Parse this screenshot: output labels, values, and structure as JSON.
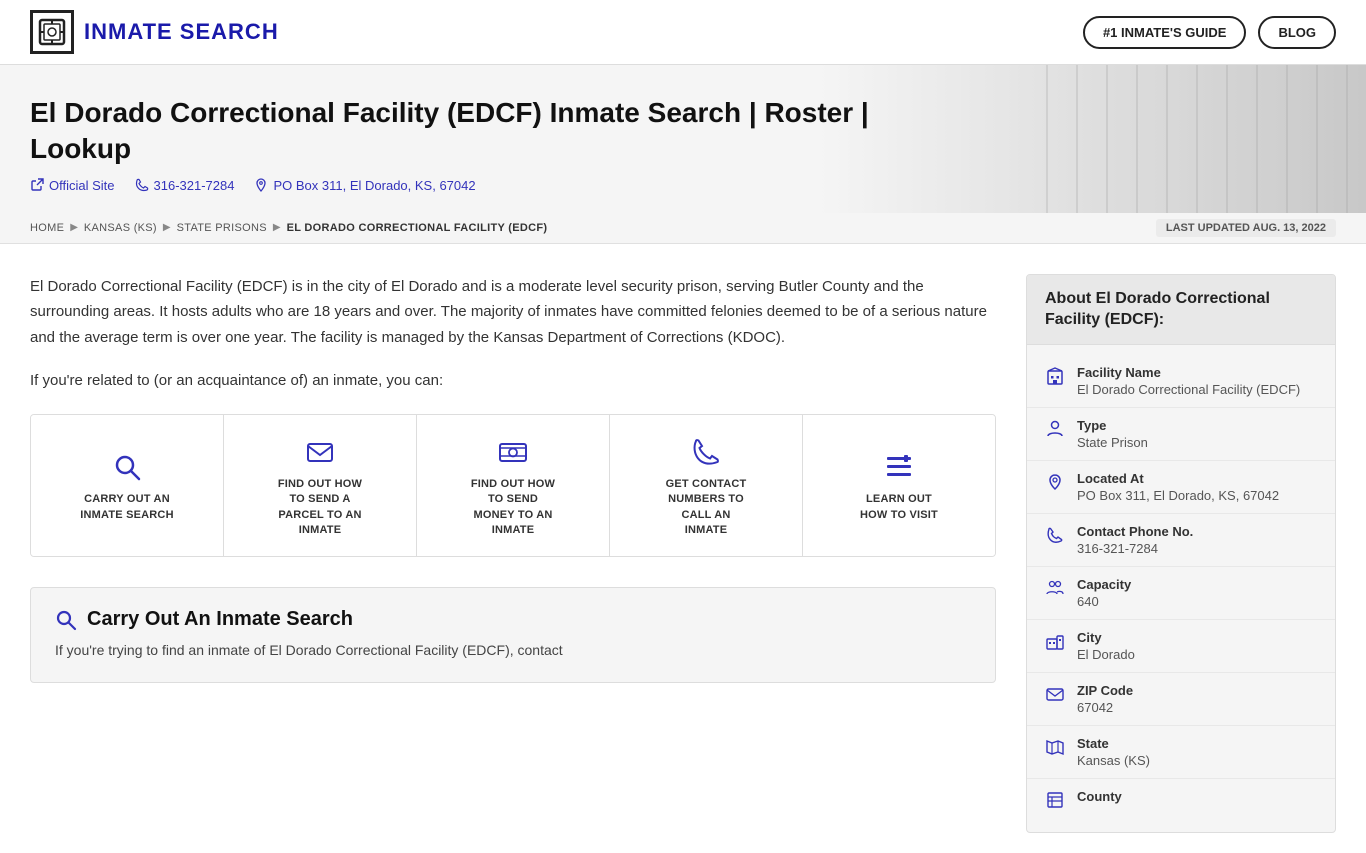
{
  "header": {
    "logo_text": "INMATE SEARCH",
    "btn_guide": "#1 INMATE'S GUIDE",
    "btn_blog": "BLOG"
  },
  "hero": {
    "title": "El Dorado Correctional Facility (EDCF) Inmate Search | Roster | Lookup",
    "official_site": "Official Site",
    "phone": "316-321-7284",
    "address": "PO Box 311, El Dorado, KS, 67042"
  },
  "breadcrumb": {
    "items": [
      "HOME",
      "KANSAS (KS)",
      "STATE PRISONS",
      "EL DORADO CORRECTIONAL FACILITY (EDCF)"
    ],
    "last_updated": "LAST UPDATED AUG. 13, 2022"
  },
  "description": {
    "para1": "El Dorado Correctional Facility (EDCF) is in the city of El Dorado and is a moderate level security prison, serving Butler County and the surrounding areas. It hosts adults who are 18 years and over. The majority of inmates have committed felonies deemed to be of a serious nature and the average term is over one year. The facility is managed by the Kansas Department of Corrections (KDOC).",
    "para2": "If you're related to (or an acquaintance of) an inmate, you can:"
  },
  "action_cards": [
    {
      "id": "search",
      "label": "CARRY OUT AN\nINMATE SEARCH",
      "icon": "search"
    },
    {
      "id": "parcel",
      "label": "FIND OUT HOW\nTO SEND A\nPARCEL TO AN\nINMATE",
      "icon": "envelope"
    },
    {
      "id": "money",
      "label": "FIND OUT HOW\nTO SEND\nMONEY TO AN\nINMATE",
      "icon": "money"
    },
    {
      "id": "contact",
      "label": "GET CONTACT\nNUMBERS TO\nCALL AN\nINMATE",
      "icon": "phone"
    },
    {
      "id": "visit",
      "label": "LEARN OUT\nHOW TO VISIT",
      "icon": "list"
    }
  ],
  "search_section": {
    "title": "Carry Out An Inmate Search",
    "body": "If you're trying to find an inmate of El Dorado Correctional Facility (EDCF), contact"
  },
  "sidebar": {
    "title": "About El Dorado Correctional\nFacility (EDCF):",
    "items": [
      {
        "label": "Facility Name",
        "value": "El Dorado Correctional Facility (EDCF)",
        "icon": "building"
      },
      {
        "label": "Type",
        "value": "State Prison",
        "icon": "person"
      },
      {
        "label": "Located At",
        "value": "PO Box 311, El Dorado, KS, 67042",
        "icon": "pin"
      },
      {
        "label": "Contact Phone No.",
        "value": "316-321-7284",
        "icon": "phone"
      },
      {
        "label": "Capacity",
        "value": "640",
        "icon": "capacity"
      },
      {
        "label": "City",
        "value": "El Dorado",
        "icon": "building2"
      },
      {
        "label": "ZIP Code",
        "value": "67042",
        "icon": "mail"
      },
      {
        "label": "State",
        "value": "Kansas (KS)",
        "icon": "map"
      },
      {
        "label": "County",
        "value": "",
        "icon": "county"
      }
    ]
  }
}
